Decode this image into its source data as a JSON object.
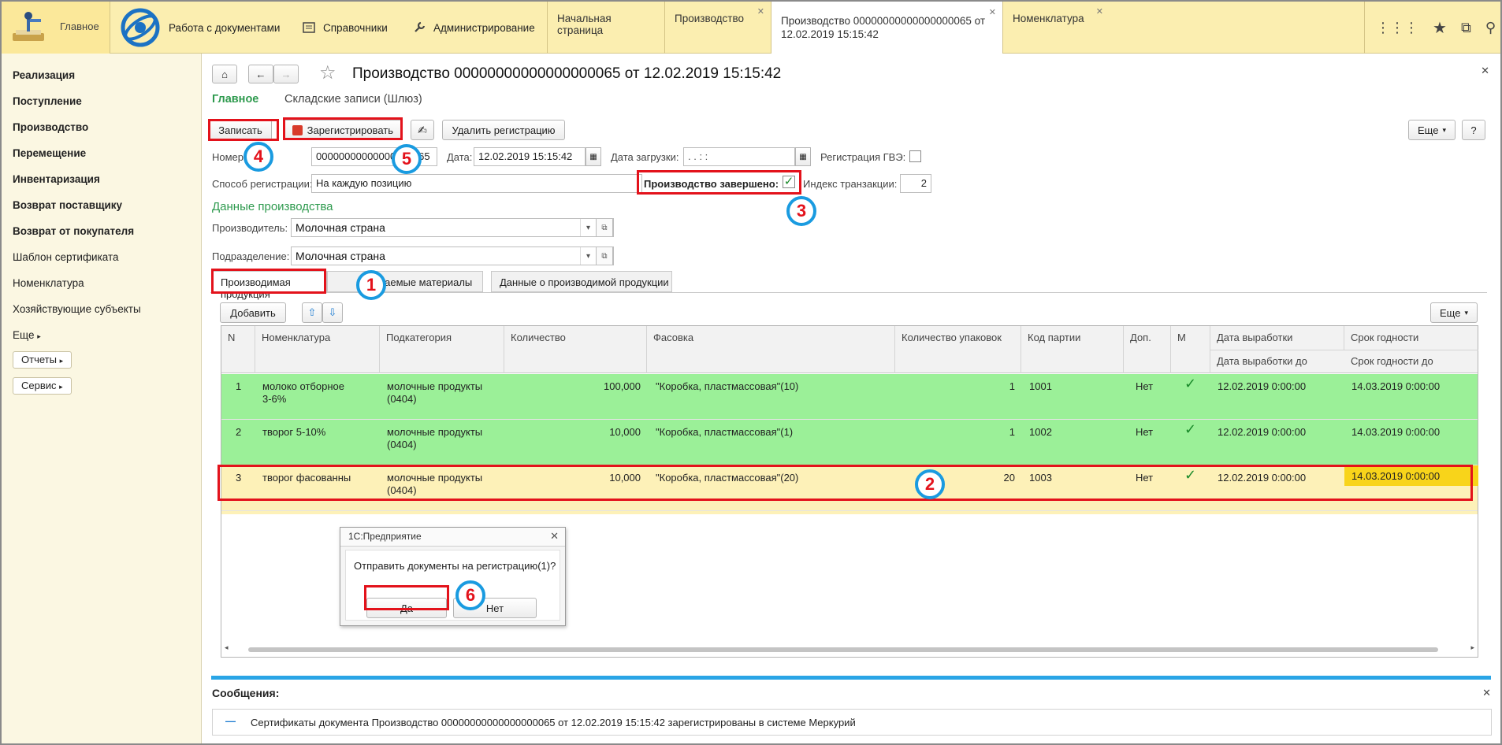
{
  "topbar": {
    "home_label": "Главное",
    "sections": [
      {
        "label": "Работа с документами",
        "icon": "globe-logo-icon"
      },
      {
        "label": "Справочники",
        "icon": "list-icon"
      },
      {
        "label": "Администрирование",
        "icon": "wrench-icon"
      }
    ],
    "tabs": [
      {
        "label": "Начальная страница"
      },
      {
        "label": "Производство",
        "closable": true
      },
      {
        "label_line1": "Производство 00000000000000000065 от",
        "label_line2": "12.02.2019 15:15:42",
        "closable": true,
        "active": true
      },
      {
        "label": "Номенклатура",
        "closable": true
      }
    ],
    "icons": [
      "apps-grid-icon",
      "star-icon",
      "history-icon",
      "search-icon"
    ]
  },
  "sidebar": {
    "items": [
      {
        "label": "Реализация",
        "bold": true
      },
      {
        "label": "Поступление",
        "bold": true
      },
      {
        "label": "Производство",
        "bold": true
      },
      {
        "label": "Перемещение",
        "bold": true
      },
      {
        "label": "Инвентаризация",
        "bold": true
      },
      {
        "label": "Возврат поставщику",
        "bold": true
      },
      {
        "label": "Возврат от покупателя",
        "bold": true
      },
      {
        "label": "Шаблон сертификата",
        "bold": false
      },
      {
        "label": "Номенклатура",
        "bold": false
      },
      {
        "label": "Хозяйствующие субъекты",
        "bold": false
      },
      {
        "label": "Еще",
        "bold": false
      }
    ],
    "buttons": [
      "Отчеты",
      "Сервис"
    ]
  },
  "document": {
    "title": "Производство 00000000000000000065 от 12.02.2019 15:15:42",
    "subtabs": [
      "Главное",
      "Складские записи (Шлюз)"
    ],
    "toolbar": {
      "save": "Записать",
      "register": "Зарегистрировать",
      "delete_registration": "Удалить регистрацию",
      "more": "Еще",
      "help": "?"
    },
    "fields": {
      "number_label": "Номер:",
      "number_value": "00000000000000000065",
      "date_label": "Дата:",
      "date_value": "12.02.2019 15:15:42",
      "load_date_label": "Дата загрузки:",
      "load_date_value": " .  .       :  :",
      "gvz_label": "Регистрация ГВЭ:",
      "method_label": "Способ регистрации:",
      "method_value": "На каждую позицию",
      "completed_label": "Производство завершено:",
      "completed_checked": true,
      "tx_index_label": "Индекс транзакции:",
      "tx_index_value": "2"
    },
    "production_section": "Данные производства",
    "producer_label": "Производитель:",
    "producer_value": "Молочная страна",
    "division_label": "Подразделение:",
    "division_value": "Молочная страна",
    "tabs": [
      "Производимая продукция",
      "Расходуемые материалы",
      "Данные о производимой продукции"
    ],
    "tabs_visible": [
      "Производимая продукция",
      "ываемые материалы",
      "Данные о производимой продукции"
    ],
    "table_toolbar": {
      "add": "Добавить",
      "more": "Еще"
    },
    "columns": {
      "n": "N",
      "nom": "Номенклатура",
      "sub": "Подкатегория",
      "qty": "Количество",
      "pack": "Фасовка",
      "pkgs": "Количество упаковок",
      "lot": "Код партии",
      "extra": "Доп.",
      "m": "М",
      "prod_date": "Дата выработки",
      "prod_date_to": "Дата выработки до",
      "expiry": "Срок годности",
      "expiry_to": "Срок годности до"
    },
    "rows": [
      {
        "n": "1",
        "nom1": "молоко отборное",
        "nom2": "3-6%",
        "sub1": "молочные продукты",
        "sub2": "(0404)",
        "qty": "100,000",
        "pack": "\"Коробка, пластмассовая\"(10)",
        "pkgs": "1",
        "lot": "1001",
        "extra": "Нет",
        "m": "✓",
        "prod_date": "12.02.2019 0:00:00",
        "expiry": "14.03.2019 0:00:00",
        "style": "green"
      },
      {
        "n": "2",
        "nom1": "творог 5-10%",
        "nom2": "",
        "sub1": "молочные продукты",
        "sub2": "(0404)",
        "qty": "10,000",
        "pack": "\"Коробка, пластмассовая\"(1)",
        "pkgs": "1",
        "lot": "1002",
        "extra": "Нет",
        "m": "✓",
        "prod_date": "12.02.2019 0:00:00",
        "expiry": "14.03.2019 0:00:00",
        "style": "green"
      },
      {
        "n": "3",
        "nom1": "творог фасованны",
        "nom2": "",
        "sub1": "молочные продукты",
        "sub2": "(0404)",
        "qty": "10,000",
        "pack": "\"Коробка, пластмассовая\"(20)",
        "pkgs": "20",
        "lot": "1003",
        "extra": "Нет",
        "m": "✓",
        "prod_date": "12.02.2019 0:00:00",
        "expiry": "14.03.2019 0:00:00",
        "style": "yellow"
      }
    ]
  },
  "dialog": {
    "title": "1С:Предприятие",
    "message": "Отправить документы на регистрацию(1)?",
    "yes": "Да",
    "no": "Нет"
  },
  "messages": {
    "header": "Сообщения:",
    "text": "Сертификаты документа Производство 00000000000000000065 от 12.02.2019 15:15:42 зарегистрированы в системе Меркурий"
  },
  "annotations": [
    "1",
    "2",
    "3",
    "4",
    "5",
    "6"
  ],
  "colors": {
    "annotation_red": "#e3121b",
    "annotation_blue": "#1a9be0",
    "row_green": "#9bf098",
    "row_yellow": "#fdf1b8",
    "section_green": "#2e9a4e"
  }
}
